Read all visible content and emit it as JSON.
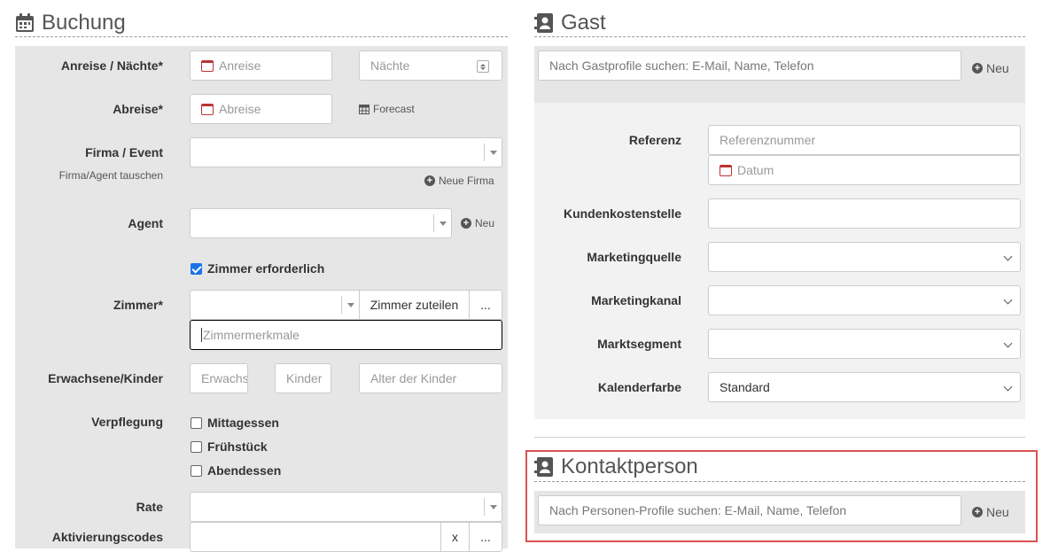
{
  "buchung": {
    "title": "Buchung",
    "anreise_label": "Anreise / Nächte*",
    "anreise_placeholder": "Anreise",
    "naechte_placeholder": "Nächte",
    "abreise_label": "Abreise*",
    "abreise_placeholder": "Abreise",
    "forecast_label": "Forecast",
    "firma_label": "Firma / Event",
    "firma_swap_label": "Firma/Agent tauschen",
    "neue_firma_label": "Neue Firma",
    "agent_label": "Agent",
    "agent_new_label": "Neu",
    "zimmer_required_label": "Zimmer erforderlich",
    "zimmer_label": "Zimmer*",
    "zimmer_assign_label": "Zimmer zuteilen",
    "more_label": "...",
    "zimmermerkmale_placeholder": "Zimmermerkmale",
    "erwachsene_label": "Erwachsene/Kinder",
    "erwachsene_placeholder": "Erwachsene",
    "kinder_placeholder": "Kinder",
    "alter_placeholder": "Alter der Kinder",
    "verpflegung_label": "Verpflegung",
    "meals": [
      "Mittagessen",
      "Frühstück",
      "Abendessen"
    ],
    "rate_label": "Rate",
    "aktivierung_label": "Aktivierungscodes",
    "clear_label": "x"
  },
  "gast": {
    "title": "Gast",
    "search_placeholder": "Nach Gastprofile suchen: E-Mail, Name, Telefon",
    "new_label": "Neu",
    "referenz_label": "Referenz",
    "referenz_placeholder": "Referenznummer",
    "datum_placeholder": "Datum",
    "kostenstelle_label": "Kundenkostenstelle",
    "marketingquelle_label": "Marketingquelle",
    "marketingkanal_label": "Marketingkanal",
    "marktsegment_label": "Marktsegment",
    "kalenderfarbe_label": "Kalenderfarbe",
    "kalenderfarbe_value": "Standard"
  },
  "kontakt": {
    "title": "Kontaktperson",
    "search_placeholder": "Nach Personen-Profile suchen: E-Mail, Name, Telefon",
    "new_label": "Neu"
  },
  "colors": {
    "panel": "#e6e6e6",
    "highlight": "#d9534f",
    "checkbox": "#1a73e8"
  }
}
